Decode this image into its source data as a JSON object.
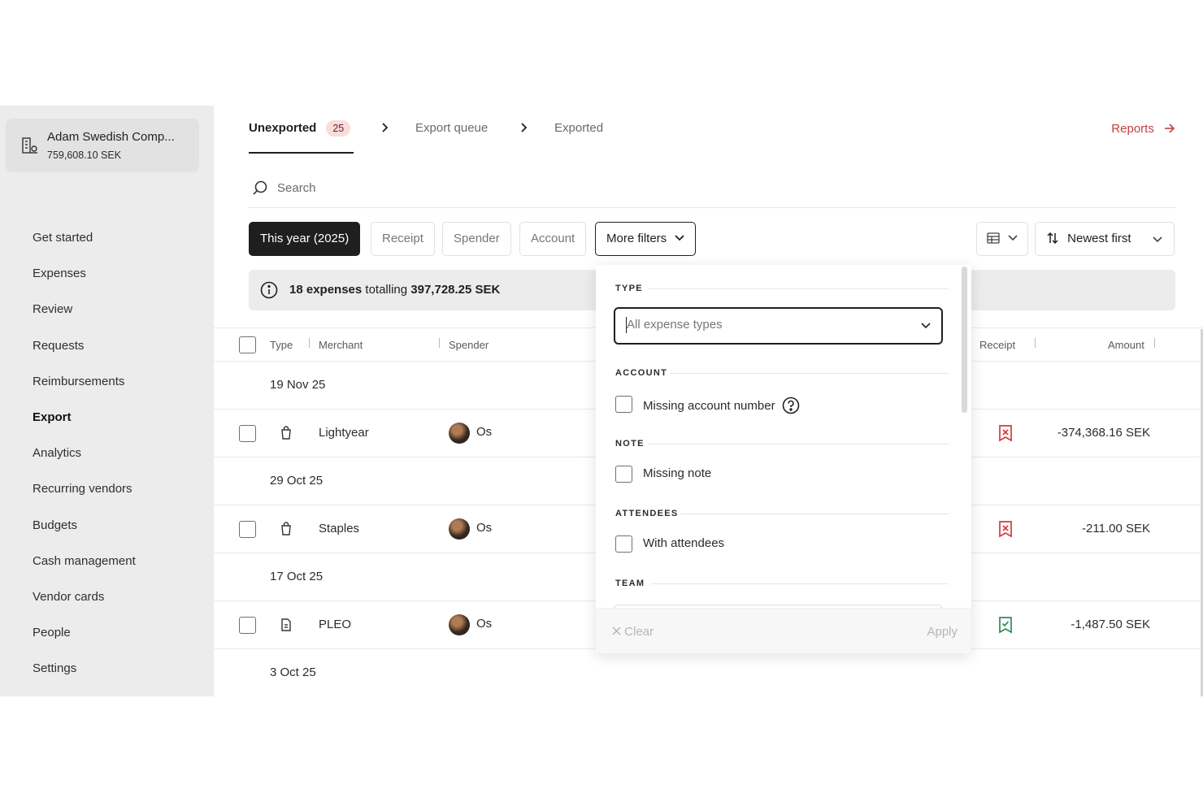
{
  "company": {
    "name": "Adam Swedish Comp...",
    "balance": "759,608.10 SEK"
  },
  "nav": [
    "Get started",
    "Expenses",
    "Review",
    "Requests",
    "Reimbursements",
    "Export",
    "Analytics",
    "Recurring vendors",
    "Budgets",
    "Cash management",
    "Vendor cards",
    "People",
    "Settings"
  ],
  "tabs": {
    "unexported": "Unexported",
    "unexported_count": "25",
    "export_queue": "Export queue",
    "exported": "Exported"
  },
  "reports_link": "Reports",
  "search": {
    "placeholder": "Search"
  },
  "filters": {
    "year": "This year (2025)",
    "receipt": "Receipt",
    "spender": "Spender",
    "account": "Account",
    "more": "More filters"
  },
  "sort": {
    "label": "Newest first"
  },
  "summary": {
    "count": "18 expenses",
    "totalling": "totalling",
    "amount": "397,728.25 SEK"
  },
  "table": {
    "headers": {
      "type": "Type",
      "merchant": "Merchant",
      "spender": "Spender",
      "receipt": "Receipt",
      "amount": "Amount"
    }
  },
  "rows": [
    {
      "date": "19 Nov 25",
      "merchant": "Lightyear",
      "spender": "Os",
      "receipt_status": "missing",
      "amount": "-374,368.16 SEK"
    },
    {
      "date": "29 Oct 25",
      "merchant": "Staples",
      "spender": "Os",
      "receipt_status": "missing",
      "amount": "-211.00 SEK"
    },
    {
      "date": "17 Oct 25",
      "merchant": "PLEO",
      "spender": "Os",
      "receipt_status": "attached",
      "amount": "-1,487.50 SEK"
    }
  ],
  "last_date": "3 Oct 25",
  "panel": {
    "type_title": "TYPE",
    "type_placeholder": "All expense types",
    "account_title": "ACCOUNT",
    "missing_account": "Missing account number",
    "note_title": "NOTE",
    "missing_note": "Missing note",
    "attendees_title": "ATTENDEES",
    "with_attendees": "With attendees",
    "team_title": "TEAM",
    "clear": "Clear",
    "apply": "Apply"
  },
  "colors": {
    "accent_red": "#c4403f",
    "receipt_ok": "#2e8b57",
    "dark": "#1f1f1f"
  }
}
